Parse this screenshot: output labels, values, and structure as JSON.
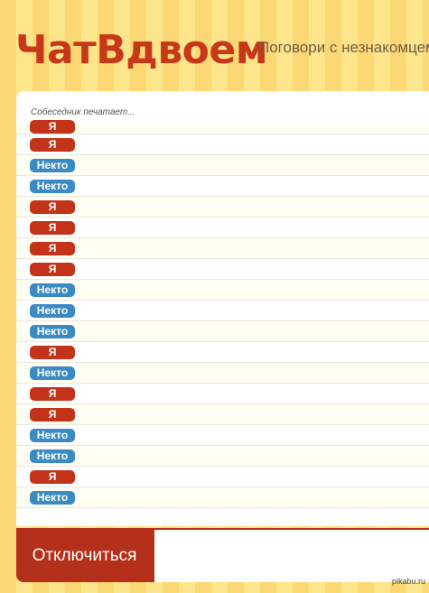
{
  "header": {
    "logo": "ЧатВдвоем",
    "tagline": "Поговори с незнакомцем"
  },
  "chat": {
    "typing_status": "Собеседник печатает...",
    "messages": [
      {
        "sender": "Я",
        "role": "me"
      },
      {
        "sender": "Я",
        "role": "me"
      },
      {
        "sender": "Некто",
        "role": "stranger"
      },
      {
        "sender": "Некто",
        "role": "stranger"
      },
      {
        "sender": "Я",
        "role": "me"
      },
      {
        "sender": "Я",
        "role": "me"
      },
      {
        "sender": "Я",
        "role": "me"
      },
      {
        "sender": "Я",
        "role": "me"
      },
      {
        "sender": "Некто",
        "role": "stranger"
      },
      {
        "sender": "Некто",
        "role": "stranger"
      },
      {
        "sender": "Некто",
        "role": "stranger"
      },
      {
        "sender": "Я",
        "role": "me"
      },
      {
        "sender": "Некто",
        "role": "stranger"
      },
      {
        "sender": "Я",
        "role": "me"
      },
      {
        "sender": "Я",
        "role": "me"
      },
      {
        "sender": "Некто",
        "role": "stranger"
      },
      {
        "sender": "Некто",
        "role": "stranger"
      },
      {
        "sender": "Я",
        "role": "me"
      },
      {
        "sender": "Некто",
        "role": "stranger"
      }
    ]
  },
  "controls": {
    "disconnect_label": "Отключиться",
    "message_input_value": ""
  },
  "watermark": "pikabu.ru",
  "colors": {
    "brand": "#c7381b",
    "me_badge": "#c3331a",
    "stranger_badge": "#3a8ac4",
    "disconnect_button": "#b5301a"
  }
}
